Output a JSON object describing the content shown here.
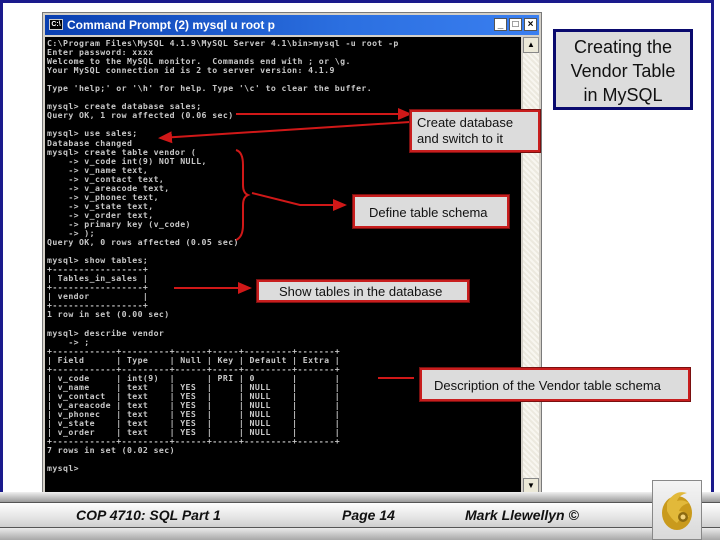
{
  "slide": {
    "title_lines": [
      "Creating the",
      "Vendor Table",
      "in MySQL"
    ],
    "footer": {
      "course": "COP 4710: SQL Part 1",
      "page": "Page 14",
      "author": "Mark Llewellyn ©"
    },
    "logo_icon": "pegasus-logo-icon"
  },
  "window": {
    "title": "Command Prompt (2)  mysql  u root  p",
    "app_icon_label": "C:\\",
    "minimize_label": "_",
    "maximize_label": "□",
    "close_label": "×",
    "scroll_up_label": "▲",
    "scroll_down_label": "▼"
  },
  "console": {
    "lines": [
      "C:\\Program Files\\MySQL 4.1.9\\MySQL Server 4.1\\bin>mysql -u root -p",
      "Enter password: xxxx",
      "Welcome to the MySQL monitor.  Commands end with ; or \\g.",
      "Your MySQL connection id is 2 to server version: 4.1.9",
      "",
      "Type 'help;' or '\\h' for help. Type '\\c' to clear the buffer.",
      "",
      "mysql> create database sales;",
      "Query OK, 1 row affected (0.06 sec)",
      "",
      "mysql> use sales;",
      "Database changed",
      "mysql> create table vendor (",
      "    -> v_code int(9) NOT NULL,",
      "    -> v_name text,",
      "    -> v_contact text,",
      "    -> v_areacode text,",
      "    -> v_phonec text,",
      "    -> v_state text,",
      "    -> v_order text,",
      "    -> primary key (v_code)",
      "    -> );",
      "Query OK, 0 rows affected (0.05 sec)",
      "",
      "mysql> show tables;",
      "+-----------------+",
      "| Tables_in_sales |",
      "+-----------------+",
      "| vendor          |",
      "+-----------------+",
      "1 row in set (0.00 sec)",
      "",
      "mysql> describe vendor",
      "    -> ;",
      "+------------+---------+------+-----+---------+-------+",
      "| Field      | Type    | Null | Key | Default | Extra |",
      "+------------+---------+------+-----+---------+-------+",
      "| v_code     | int(9)  |      | PRI | 0       |       |",
      "| v_name     | text    | YES  |     | NULL    |       |",
      "| v_contact  | text    | YES  |     | NULL    |       |",
      "| v_areacode | text    | YES  |     | NULL    |       |",
      "| v_phonec   | text    | YES  |     | NULL    |       |",
      "| v_state    | text    | YES  |     | NULL    |       |",
      "| v_order    | text    | YES  |     | NULL    |       |",
      "+------------+---------+------+-----+---------+-------+",
      "7 rows in set (0.02 sec)",
      "",
      "mysql>"
    ]
  },
  "callouts": {
    "create_db": [
      "Create database",
      "and switch to it"
    ],
    "define_schema": "Define table schema",
    "show_tables": "Show tables in the database",
    "describe": "Description of the Vendor table schema"
  },
  "colors": {
    "callout_border": "#c81e1e",
    "title_border": "#0a0a6e",
    "arrow": "#d01818",
    "console_bg": "#000000",
    "titlebar": "#0a3fb0"
  }
}
